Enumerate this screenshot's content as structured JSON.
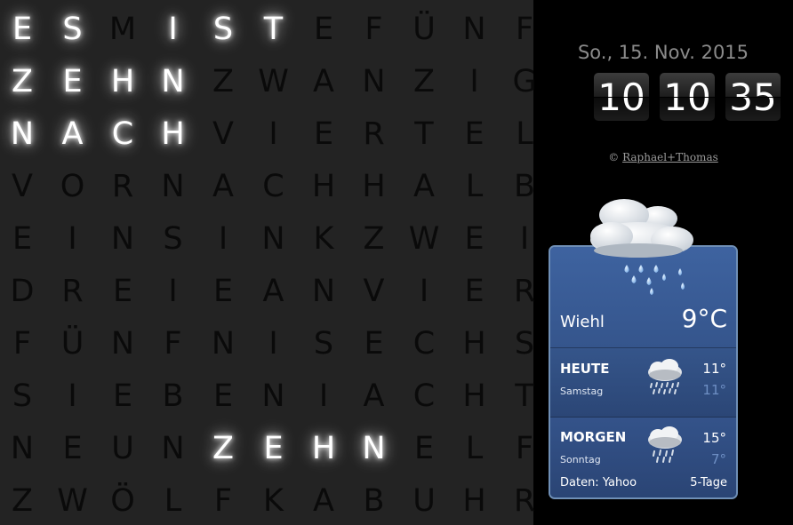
{
  "word_clock": {
    "rows": [
      [
        "E",
        "S",
        "M",
        "I",
        "S",
        "T",
        "E",
        "F",
        "Ü",
        "N",
        "F"
      ],
      [
        "Z",
        "E",
        "H",
        "N",
        "Z",
        "W",
        "A",
        "N",
        "Z",
        "I",
        "G"
      ],
      [
        "N",
        "A",
        "C",
        "H",
        "V",
        "I",
        "E",
        "R",
        "T",
        "E",
        "L"
      ],
      [
        "V",
        "O",
        "R",
        "N",
        "A",
        "C",
        "H",
        "H",
        "A",
        "L",
        "B"
      ],
      [
        "E",
        "I",
        "N",
        "S",
        "I",
        "N",
        "K",
        "Z",
        "W",
        "E",
        "I"
      ],
      [
        "D",
        "R",
        "E",
        "I",
        "E",
        "A",
        "N",
        "V",
        "I",
        "E",
        "R"
      ],
      [
        "F",
        "Ü",
        "N",
        "F",
        "N",
        "I",
        "S",
        "E",
        "C",
        "H",
        "S"
      ],
      [
        "S",
        "I",
        "E",
        "B",
        "E",
        "N",
        "I",
        "A",
        "C",
        "H",
        "T"
      ],
      [
        "N",
        "E",
        "U",
        "N",
        "Z",
        "E",
        "H",
        "N",
        "E",
        "L",
        "F"
      ],
      [
        "Z",
        "W",
        "Ö",
        "L",
        "F",
        "K",
        "A",
        "B",
        "U",
        "H",
        "R"
      ]
    ],
    "lit": [
      [
        1,
        1,
        0,
        1,
        1,
        1,
        0,
        0,
        0,
        0,
        0
      ],
      [
        1,
        1,
        1,
        1,
        0,
        0,
        0,
        0,
        0,
        0,
        0
      ],
      [
        1,
        1,
        1,
        1,
        0,
        0,
        0,
        0,
        0,
        0,
        0
      ],
      [
        0,
        0,
        0,
        0,
        0,
        0,
        0,
        0,
        0,
        0,
        0
      ],
      [
        0,
        0,
        0,
        0,
        0,
        0,
        0,
        0,
        0,
        0,
        0
      ],
      [
        0,
        0,
        0,
        0,
        0,
        0,
        0,
        0,
        0,
        0,
        0
      ],
      [
        0,
        0,
        0,
        0,
        0,
        0,
        0,
        0,
        0,
        0,
        0
      ],
      [
        0,
        0,
        0,
        0,
        0,
        0,
        0,
        0,
        0,
        0,
        0
      ],
      [
        0,
        0,
        0,
        0,
        1,
        1,
        1,
        1,
        0,
        0,
        0
      ],
      [
        0,
        0,
        0,
        0,
        0,
        0,
        0,
        0,
        0,
        0,
        0
      ]
    ]
  },
  "date": "So., 15. Nov. 2015",
  "time": {
    "hours": "10",
    "minutes": "10",
    "seconds": "35"
  },
  "copyright": {
    "symbol": "©",
    "link": "Raphael+Thomas"
  },
  "weather": {
    "location": "Wiehl",
    "current_temp": "9°C",
    "forecast": [
      {
        "day": "HEUTE",
        "weekday": "Samstag",
        "high": "11°",
        "low": "11°",
        "icon": "cloud-rain-icon"
      },
      {
        "day": "MORGEN",
        "weekday": "Sonntag",
        "high": "15°",
        "low": "7°",
        "icon": "cloud-rain-icon"
      }
    ],
    "source": "Daten: Yahoo",
    "days_link": "5-Tage"
  },
  "colors": {
    "clock_bg": "#232323",
    "lit_letter": "#ffffff",
    "unlit_letter": "#0a0a0a",
    "widget_blue": "#35558c"
  }
}
